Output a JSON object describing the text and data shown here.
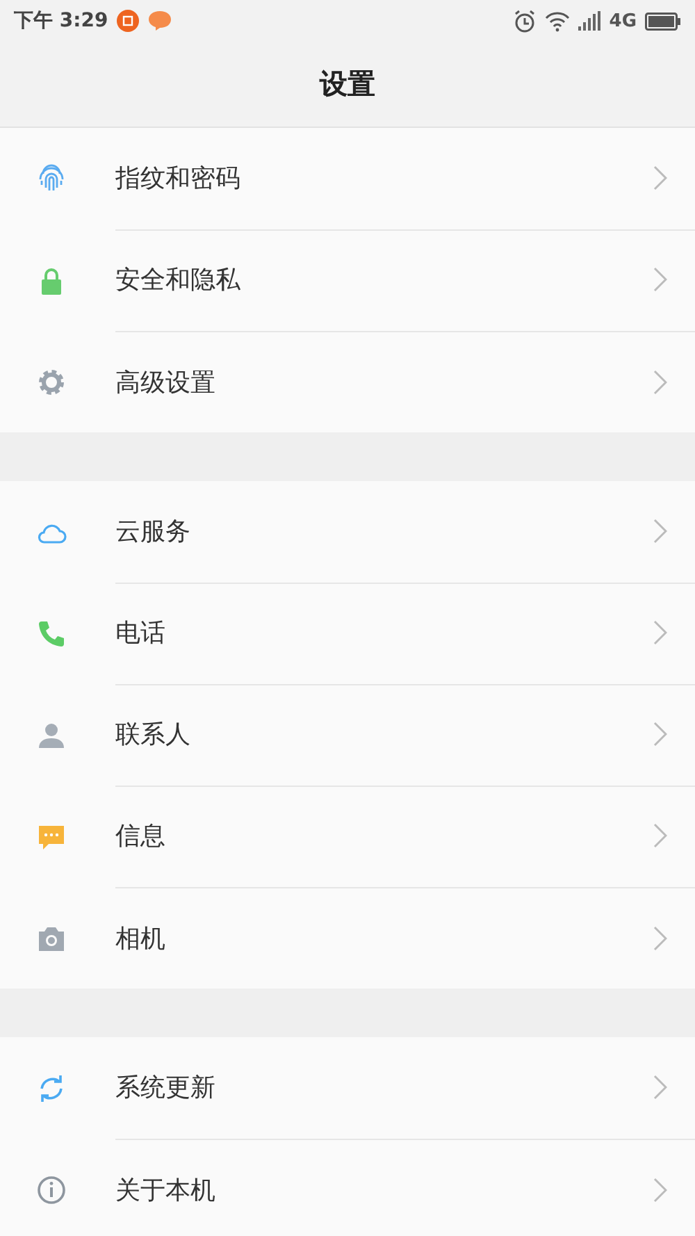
{
  "status_bar": {
    "time": "下午 3:29",
    "network": "4G"
  },
  "header": {
    "title": "设置"
  },
  "groups": [
    {
      "items": [
        {
          "label": "指纹和密码",
          "kind": "fingerprint"
        },
        {
          "label": "安全和隐私",
          "kind": "lock"
        },
        {
          "label": "高级设置",
          "kind": "gear"
        }
      ]
    },
    {
      "items": [
        {
          "label": "云服务",
          "kind": "cloud"
        },
        {
          "label": "电话",
          "kind": "phone"
        },
        {
          "label": "联系人",
          "kind": "person"
        },
        {
          "label": "信息",
          "kind": "message"
        },
        {
          "label": "相机",
          "kind": "camera"
        }
      ]
    },
    {
      "items": [
        {
          "label": "系统更新",
          "kind": "sync"
        },
        {
          "label": "关于本机",
          "kind": "info"
        }
      ]
    }
  ]
}
